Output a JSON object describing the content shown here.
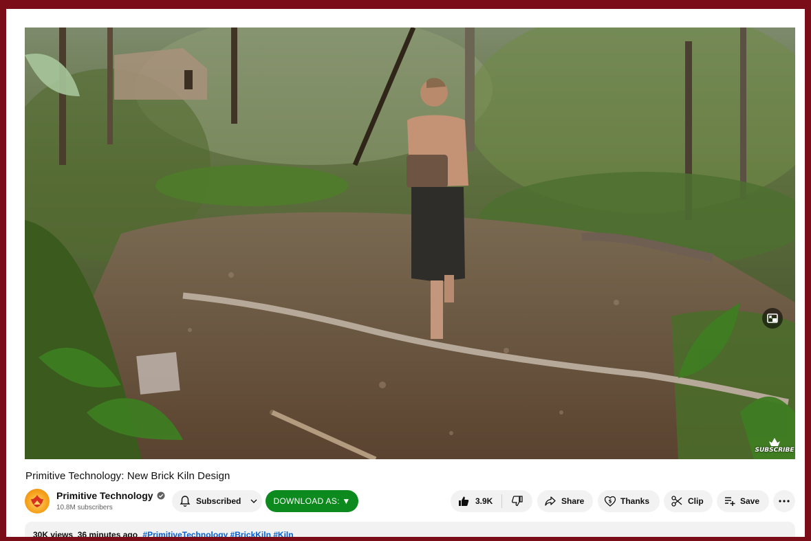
{
  "video": {
    "title": "Primitive Technology: New Brick Kiln Design",
    "watermark_label": "SUBSCRIBE"
  },
  "channel": {
    "name": "Primitive Technology",
    "subscribers": "10.8M subscribers",
    "verified": true
  },
  "actions": {
    "subscribed_label": "Subscribed",
    "download_label": "DOWNLOAD AS: ▼",
    "like_count": "3.9K",
    "share_label": "Share",
    "thanks_label": "Thanks",
    "clip_label": "Clip",
    "save_label": "Save"
  },
  "description": {
    "stats": "30K views  36 minutes ago",
    "tags": "#PrimitiveTechnology #BrickKiln #Kiln"
  },
  "colors": {
    "frame": "#7a0d17",
    "download_button": "#0c8a1e",
    "pill_background": "#f2f2f2",
    "tag_link": "#065fd4"
  },
  "icons": [
    "bell-icon",
    "chevron-down-icon",
    "thumbs-up-icon",
    "thumbs-down-icon",
    "share-icon",
    "thanks-icon",
    "scissors-icon",
    "playlist-add-icon",
    "more-icon",
    "verified-icon",
    "pip-icon"
  ]
}
